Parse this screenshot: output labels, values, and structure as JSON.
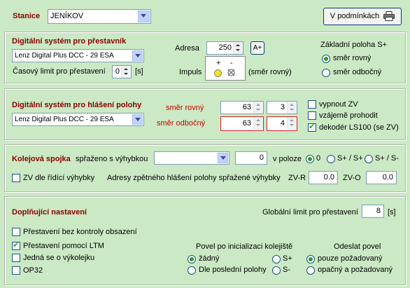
{
  "stanice": {
    "label": "Stanice",
    "value": "JENÍKOV"
  },
  "toolbar": {
    "print_label": "V podmínkách"
  },
  "turnout": {
    "title": "Digitální systém pro přestavník",
    "system": "Lenz Digital Plus DCC - 29 ESA",
    "time_limit_label": "Časový limit pro přestavení",
    "time_limit_value": "0",
    "time_unit": "[s]",
    "address_label": "Adresa",
    "address_value": "250",
    "aplus_label": "A+",
    "impuls_label": "Impuls",
    "plus": "+",
    "minus": "-",
    "direction_note": "(směr rovný)",
    "basic_pos_label": "Základní poloha S+",
    "opt_straight": "směr rovný",
    "opt_branch": "směr odbočný"
  },
  "feedback": {
    "title": "Digitální systém pro hlášení polohy",
    "system": "Lenz Digital Plus DCC - 29 ESA",
    "straight_label": "směr rovný",
    "straight_a": "63",
    "straight_b": "3",
    "branch_label": "směr odbočný",
    "branch_a": "63",
    "branch_b": "4",
    "chk_zv": "vypnout ZV",
    "chk_swap": "vzájemě prohodit",
    "chk_decoder": "dekodér LS100 (se ZV)"
  },
  "coupling": {
    "title": "Kolejová spojka",
    "coupled_label": "spřaženo s výhybkou",
    "coupled_select": "",
    "coupled_value": "0",
    "position_label": "v poloze",
    "opt0": "0",
    "opt1": "S+ / S+",
    "opt2": "S+ / S-",
    "chk_zv_label": "ZV dle řídící výhybky",
    "addr_label": "Adresy zpětného hlášení polohy spřažené výhybky",
    "zvr_label": "ZV-R",
    "zvr_value": "0.0",
    "zvo_label": "ZV-O",
    "zvo_value": "0.0"
  },
  "extra": {
    "title": "Doplňující nastavení",
    "global_limit_label": "Globální limit pro přestavení",
    "global_limit_value": "8",
    "global_unit": "[s]",
    "chk1": "Přestavení bez kontroly obsazení",
    "chk2": "Přestavení pomocí LTM",
    "chk3": "Jedná se o výkolejku",
    "chk4": "OP32",
    "init_title": "Povel po inicializaci kolejiště",
    "init_none": "žádný",
    "init_last": "Dle poslední polohy",
    "init_splus": "S+",
    "init_sminus": "S-",
    "send_title": "Odeslat povel",
    "send_req": "pouze požadovaný",
    "send_opp": "opačný a požadovaný"
  }
}
